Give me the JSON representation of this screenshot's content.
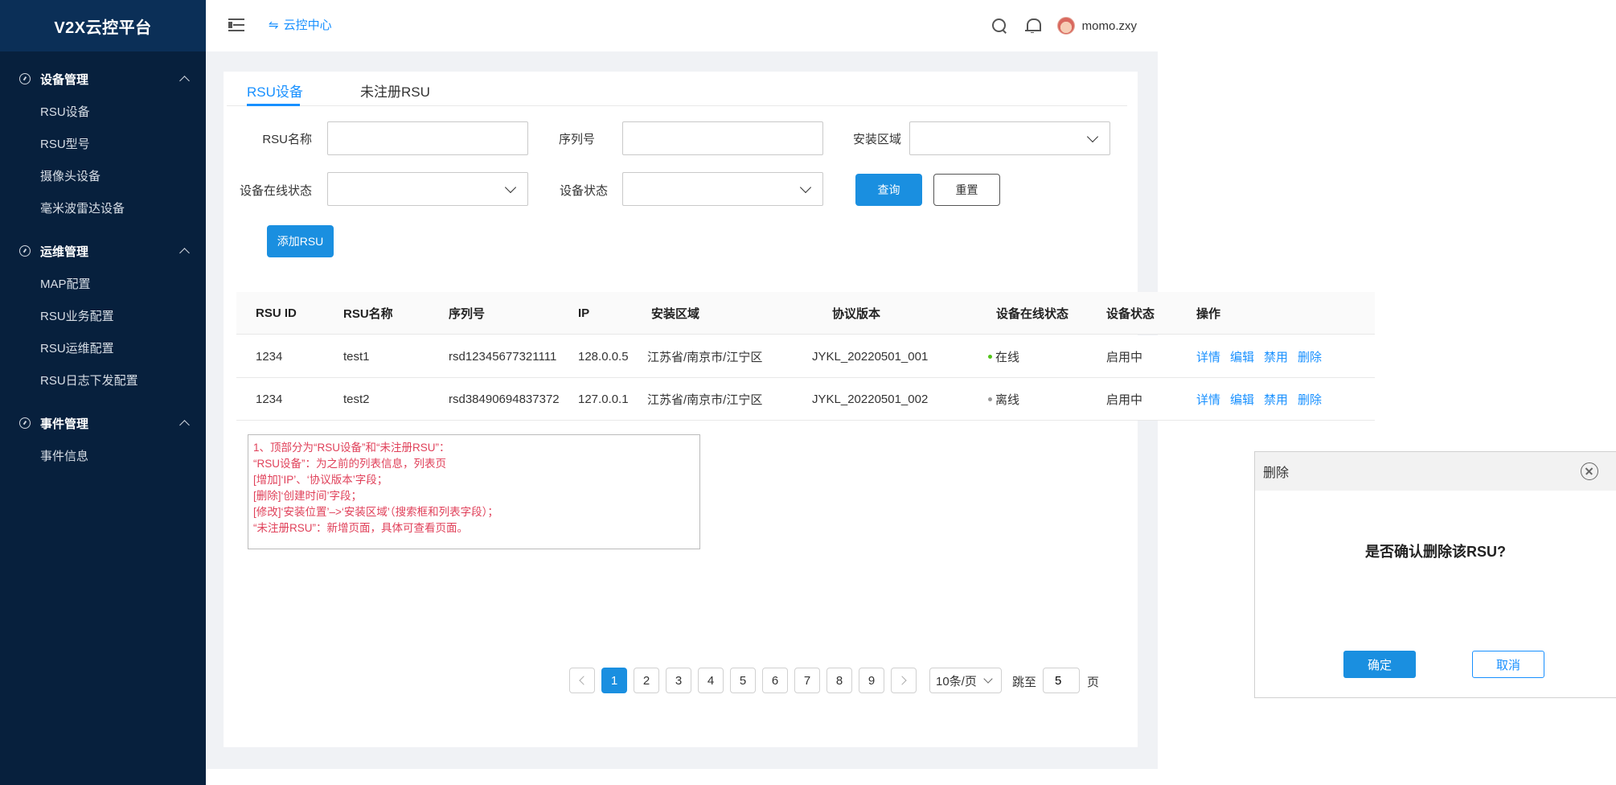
{
  "app": {
    "title": "V2X云控平台"
  },
  "sidebar": {
    "groups": [
      {
        "label": "设备管理",
        "items": [
          "RSU设备",
          "RSU型号",
          "摄像头设备",
          "毫米波雷达设备"
        ]
      },
      {
        "label": "运维管理",
        "items": [
          "MAP配置",
          "RSU业务配置",
          "RSU运维配置",
          "RSU日志下发配置"
        ]
      },
      {
        "label": "事件管理",
        "items": [
          "事件信息"
        ]
      }
    ]
  },
  "header": {
    "cloud_center": "云控中心",
    "swap_symbol": "⇋",
    "username": "momo.zxy"
  },
  "tabs": [
    {
      "label": "RSU设备",
      "active": true
    },
    {
      "label": "未注册RSU",
      "active": false
    }
  ],
  "filters": {
    "rsu_name_label": "RSU名称",
    "rsu_name_value": "",
    "serial_label": "序列号",
    "serial_value": "",
    "area_label": "安装区域",
    "online_status_label": "设备在线状态",
    "device_status_label": "设备状态",
    "query_label": "查询",
    "reset_label": "重置",
    "add_label": "添加RSU"
  },
  "table": {
    "columns": [
      "RSU ID",
      "RSU名称",
      "序列号",
      "IP",
      "安装区域",
      "协议版本",
      "设备在线状态",
      "设备状态",
      "操作"
    ],
    "rows": [
      {
        "id": "1234",
        "name": "test1",
        "serial": "rsd12345677321111",
        "ip": "128.0.0.5",
        "area": "江苏省/南京市/江宁区",
        "version": "JYKL_20220501_001",
        "online": "在线",
        "online_color": "#52c41a",
        "status": "启用中"
      },
      {
        "id": "1234",
        "name": "test2",
        "serial": "rsd38490694837372",
        "ip": "127.0.0.1",
        "area": "江苏省/南京市/江宁区",
        "version": "JYKL_20220501_002",
        "online": "离线",
        "online_color": "#999999",
        "status": "启用中"
      }
    ],
    "actions": [
      "详情",
      "编辑",
      "禁用",
      "删除"
    ]
  },
  "note": {
    "lines": [
      "1、顶部分为“RSU设备”和“未注册RSU”：",
      "“RSU设备”：为之前的列表信息，列表页",
      "[增加]‘IP’、‘协议版本’字段；",
      "[删除]‘创建时间’字段；",
      "[修改]‘安装位置’–>‘安装区域’（搜索框和列表字段）；",
      "“未注册RSU”：新增页面，具体可查看页面。"
    ]
  },
  "pagination": {
    "pages": [
      "1",
      "2",
      "3",
      "4",
      "5",
      "6",
      "7",
      "8",
      "9"
    ],
    "current": "1",
    "page_size": "10条/页",
    "jump_label": "跳至",
    "jump_value": "5",
    "page_suffix": "页"
  },
  "dialog": {
    "title": "删除",
    "message": "是否确认删除该RSU?",
    "confirm": "确定",
    "cancel": "取消"
  },
  "colors": {
    "sidebar": "#07203d",
    "logo_bg": "#0b2f57",
    "accent": "#1890ff",
    "note_text": "#e0415a"
  }
}
